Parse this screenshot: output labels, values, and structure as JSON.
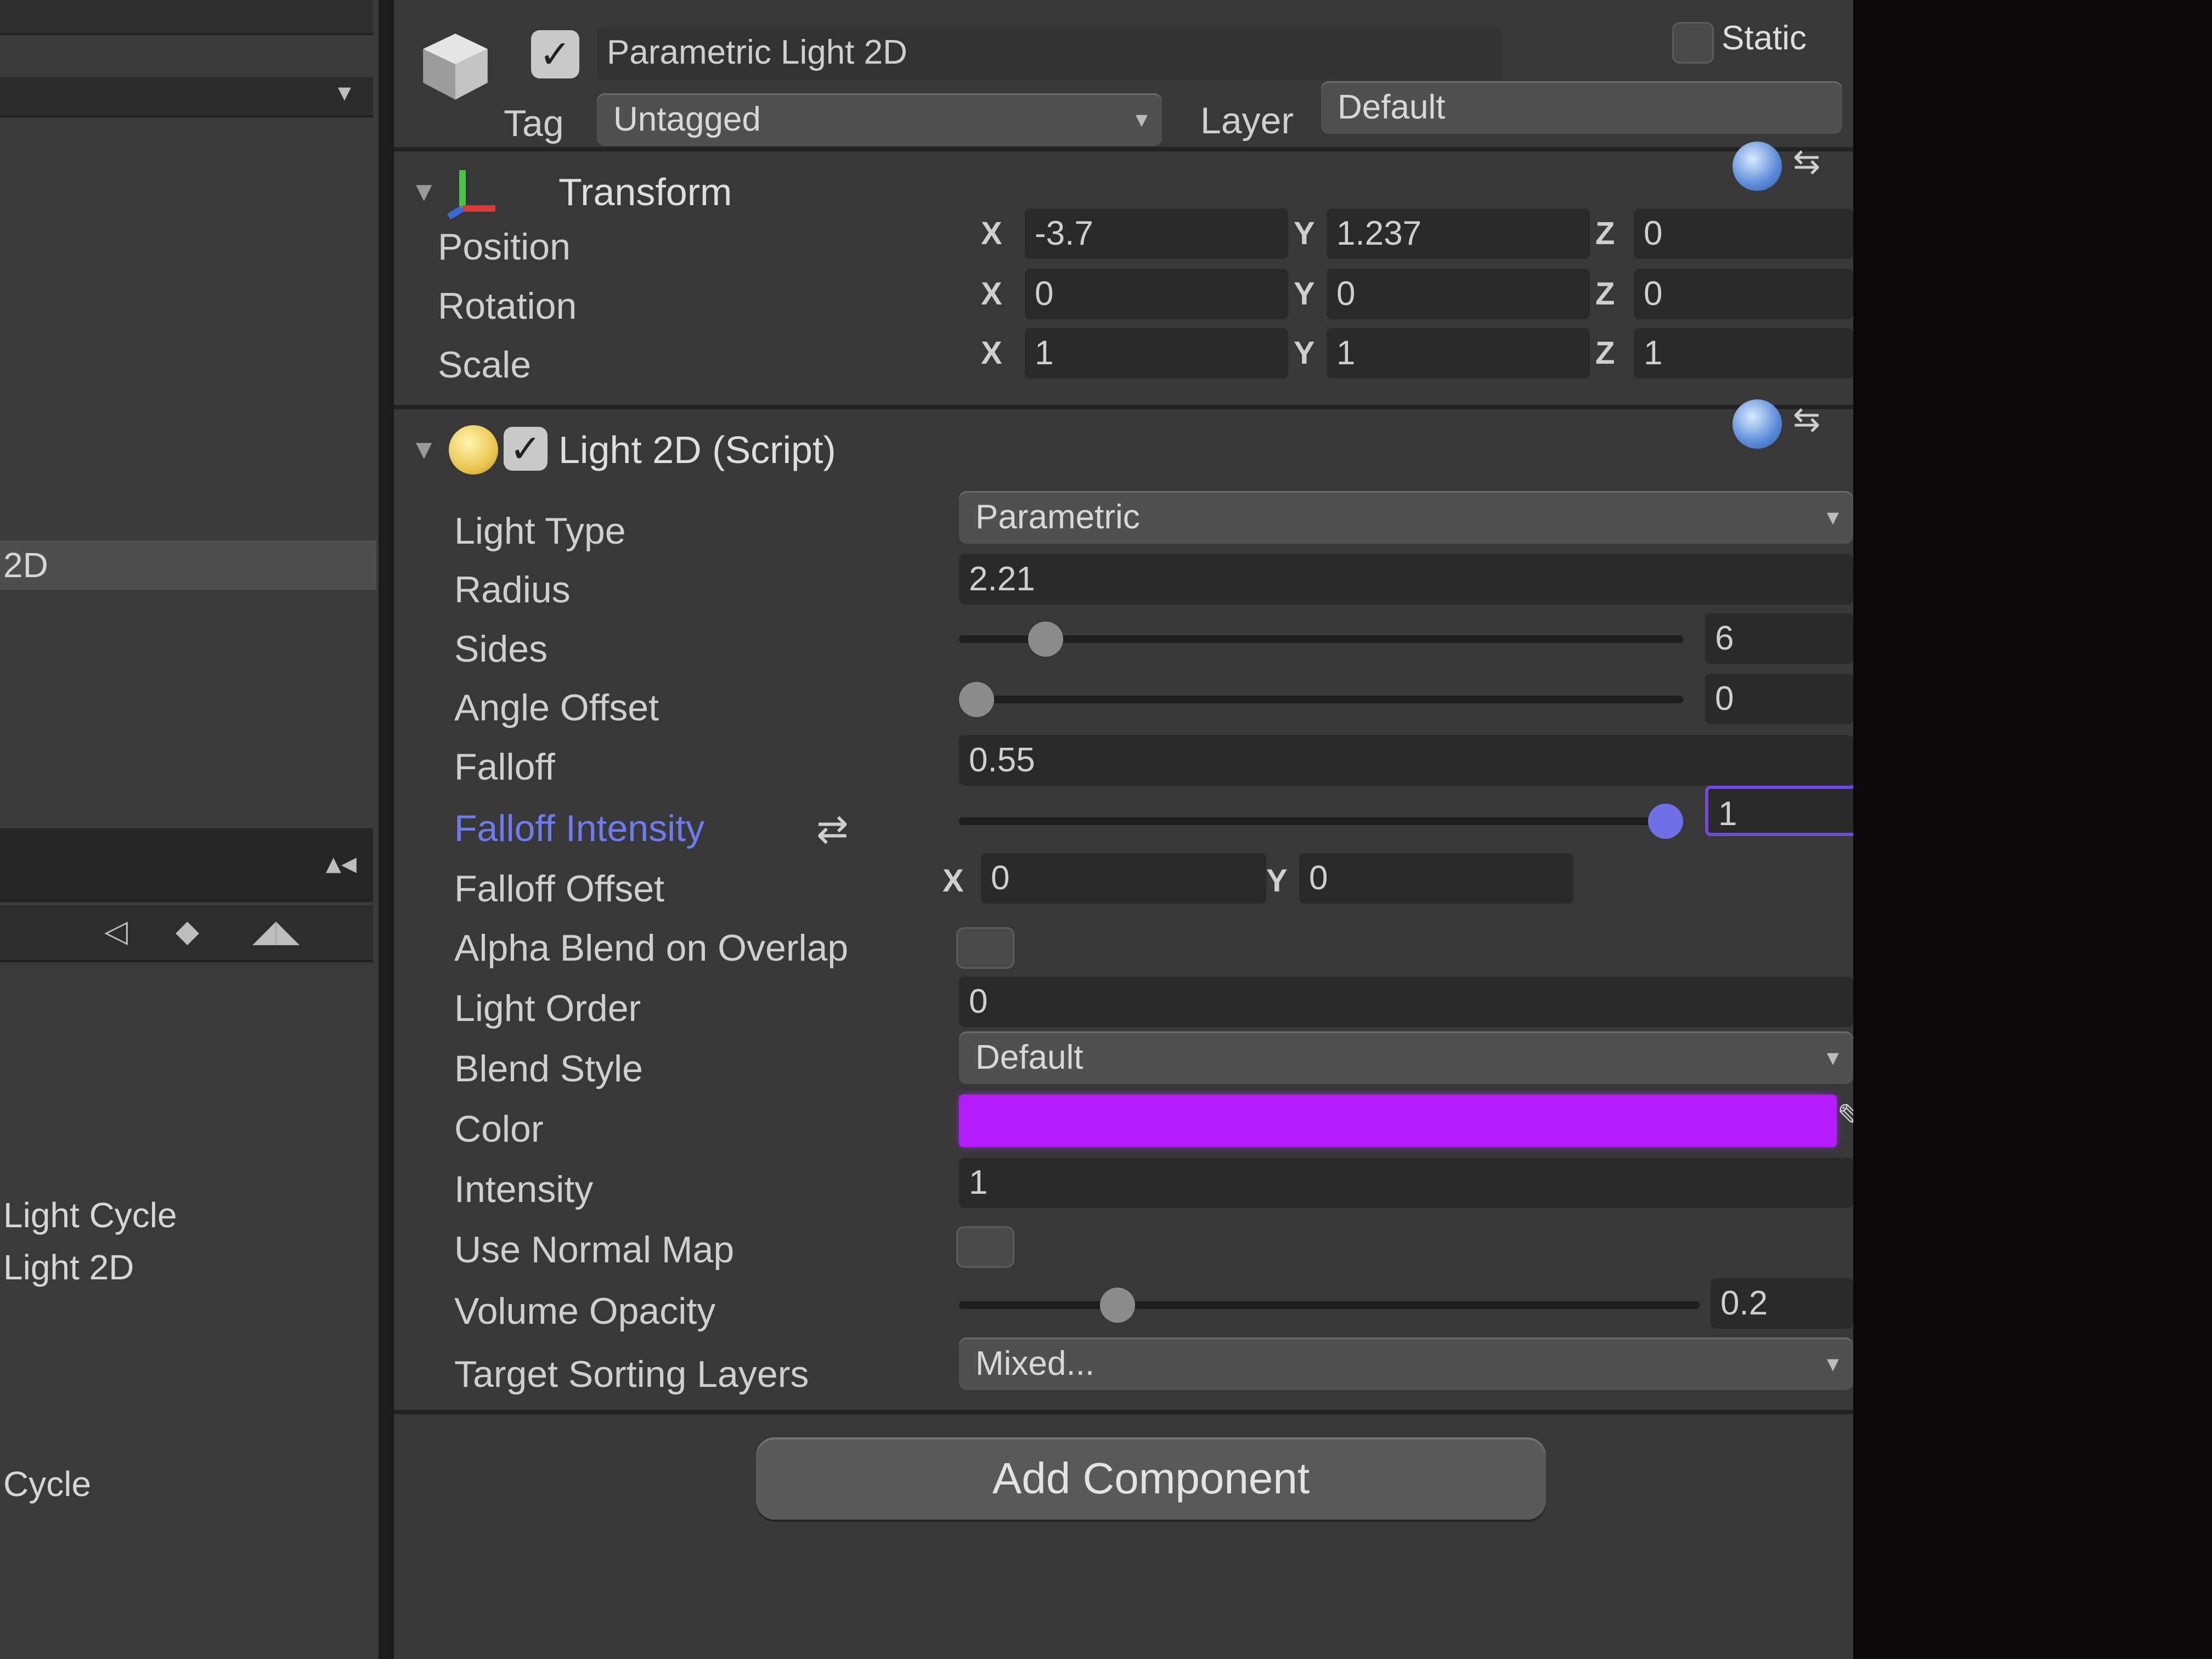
{
  "colors": {
    "light_color": "#b21cff",
    "active_label": "#6f7bf0"
  },
  "hierarchy": {
    "selected_item": "2D",
    "items": [
      "Light Cycle",
      "Light 2D",
      "Cycle"
    ]
  },
  "object_header": {
    "name": "Parametric Light 2D",
    "static_label": "Static",
    "tag_label": "Tag",
    "tag_value": "Untagged",
    "layer_label": "Layer",
    "layer_value": "Default"
  },
  "transform": {
    "title": "Transform",
    "position": {
      "label": "Position",
      "x": "-3.7",
      "y": "1.237",
      "z": "0"
    },
    "rotation": {
      "label": "Rotation",
      "x": "0",
      "y": "0",
      "z": "0"
    },
    "scale": {
      "label": "Scale",
      "x": "1",
      "y": "1",
      "z": "1"
    },
    "axis_x": "X",
    "axis_y": "Y",
    "axis_z": "Z"
  },
  "light2d": {
    "title": "Light 2D (Script)",
    "light_type": {
      "label": "Light Type",
      "value": "Parametric"
    },
    "radius": {
      "label": "Radius",
      "value": "2.21"
    },
    "sides": {
      "label": "Sides",
      "value": "6",
      "slider_fraction": 0.1
    },
    "angle_offset": {
      "label": "Angle Offset",
      "value": "0",
      "slider_fraction": 0.0
    },
    "falloff": {
      "label": "Falloff",
      "value": "0.55"
    },
    "falloff_intensity": {
      "label": "Falloff Intensity",
      "value": "1",
      "slider_fraction": 1.0
    },
    "falloff_offset": {
      "label": "Falloff Offset",
      "x": "0",
      "y": "0"
    },
    "alpha_blend": {
      "label": "Alpha Blend on Overlap"
    },
    "light_order": {
      "label": "Light Order",
      "value": "0"
    },
    "blend_style": {
      "label": "Blend Style",
      "value": "Default"
    },
    "color": {
      "label": "Color"
    },
    "intensity": {
      "label": "Intensity",
      "value": "1"
    },
    "use_normal_map": {
      "label": "Use Normal Map"
    },
    "volume_opacity": {
      "label": "Volume Opacity",
      "value": "0.2",
      "slider_fraction": 0.2
    },
    "target_sorting_layers": {
      "label": "Target Sorting Layers",
      "value": "Mixed..."
    }
  },
  "add_component": "Add Component"
}
